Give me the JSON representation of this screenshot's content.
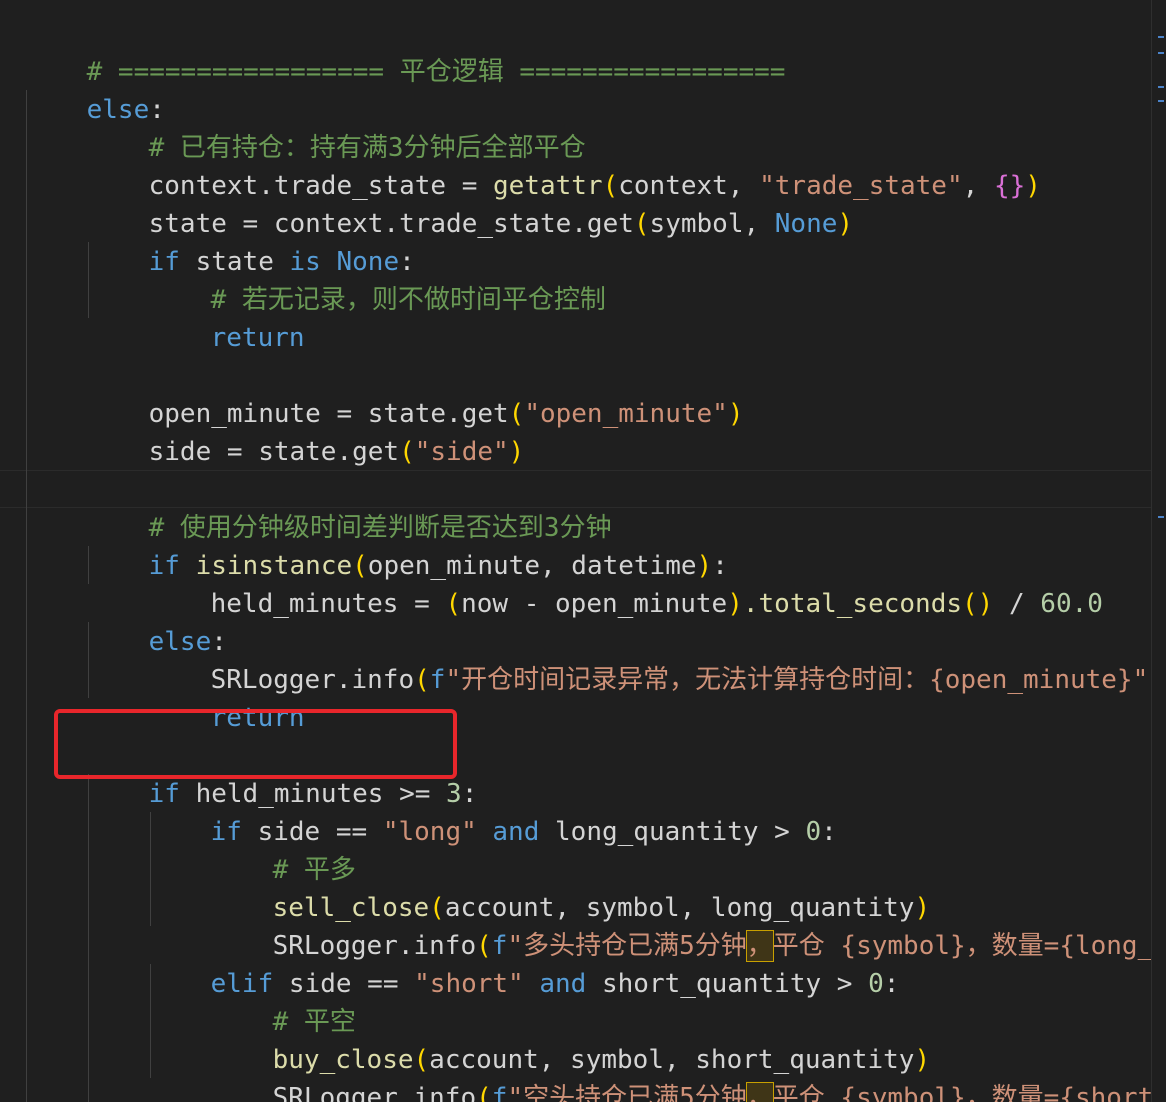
{
  "code": {
    "l1_comment": "# ================= 平仓逻辑 =================",
    "l2_else": "else",
    "l2_colon": ":",
    "l3_comment": "# 已有持仓：持有满3分钟后全部平仓",
    "l4_lhs": "context.trade_state = ",
    "l4_fn": "getattr",
    "l4_args": "context, ",
    "l4_str": "\"trade_state\"",
    "l4_comma": ", ",
    "l4_braces": "{}",
    "l5_lhs": "state = context.trade_state.get",
    "l5_args": "symbol, ",
    "l5_none": "None",
    "l6_if": "if",
    "l6_mid": " state ",
    "l6_is": "is",
    "l6_none": "None",
    "l6_colon": ":",
    "l7_comment": "# 若无记录，则不做时间平仓控制",
    "l8_return": "return",
    "l10_lhs": "open_minute = state.get",
    "l10_str": "\"open_minute\"",
    "l11_lhs": "side = state.get",
    "l11_str": "\"side\"",
    "l13_comment": "# 使用分钟级时间差判断是否达到3分钟",
    "l14_if": "if",
    "l14_fn": "isinstance",
    "l14_args": "open_minute, datetime",
    "l14_colon": ":",
    "l15_lhs": "held_minutes = ",
    "l15_inner": "now - open_minute",
    "l15_method": ".total_seconds",
    "l15_call": "()",
    "l15_div": " / ",
    "l15_num": "60.0",
    "l16_else": "else",
    "l16_colon": ":",
    "l17_obj": "SRLogger.info",
    "l17_f": "f",
    "l17_str": "\"开仓时间记录异常，无法计算持仓时间：",
    "l17_interp": "{open_minute}",
    "l17_end": "\"",
    "l18_return": "return",
    "l20_if": "if",
    "l20_mid": " held_minutes >= ",
    "l20_num": "3",
    "l20_colon": ":",
    "l21_if": "if",
    "l21_mid": " side == ",
    "l21_str": "\"long\"",
    "l21_and": "and",
    "l21_rest": " long_quantity > ",
    "l21_num": "0",
    "l21_colon": ":",
    "l22_comment": "# 平多",
    "l23_fn": "sell_close",
    "l23_args": "account, symbol, long_quantity",
    "l24_obj": "SRLogger.info",
    "l24_f": "f",
    "l24_str1": "\"多头持仓已满5分钟",
    "l24_comma": "，",
    "l24_str2": "平仓 ",
    "l24_interp1": "{symbol}",
    "l24_str3": "，数量=",
    "l24_interp2": "{long_qua",
    "l25_elif": "elif",
    "l25_mid": " side == ",
    "l25_str": "\"short\"",
    "l25_and": "and",
    "l25_rest": " short_quantity > ",
    "l25_num": "0",
    "l25_colon": ":",
    "l26_comment": "# 平空",
    "l27_fn": "buy_close",
    "l27_args": "account, symbol, short_quantity",
    "l28_obj": "SRLogger.info",
    "l28_f": "f",
    "l28_str1": "\"空头持仓已满5分钟",
    "l28_comma": "，",
    "l28_str2": "平仓 ",
    "l28_interp1": "{symbol}",
    "l28_str3": "，数量=",
    "l28_interp2": "{short_qu"
  },
  "colors": {
    "background": "#1f1f1f",
    "keyword": "#569cd6",
    "function": "#dcdcaa",
    "string": "#ce9178",
    "number": "#b5cea8",
    "comment": "#6a9955",
    "bracket_level1": "#ffd700",
    "bracket_level2": "#da70d6",
    "highlight_box": "#e8262b"
  }
}
